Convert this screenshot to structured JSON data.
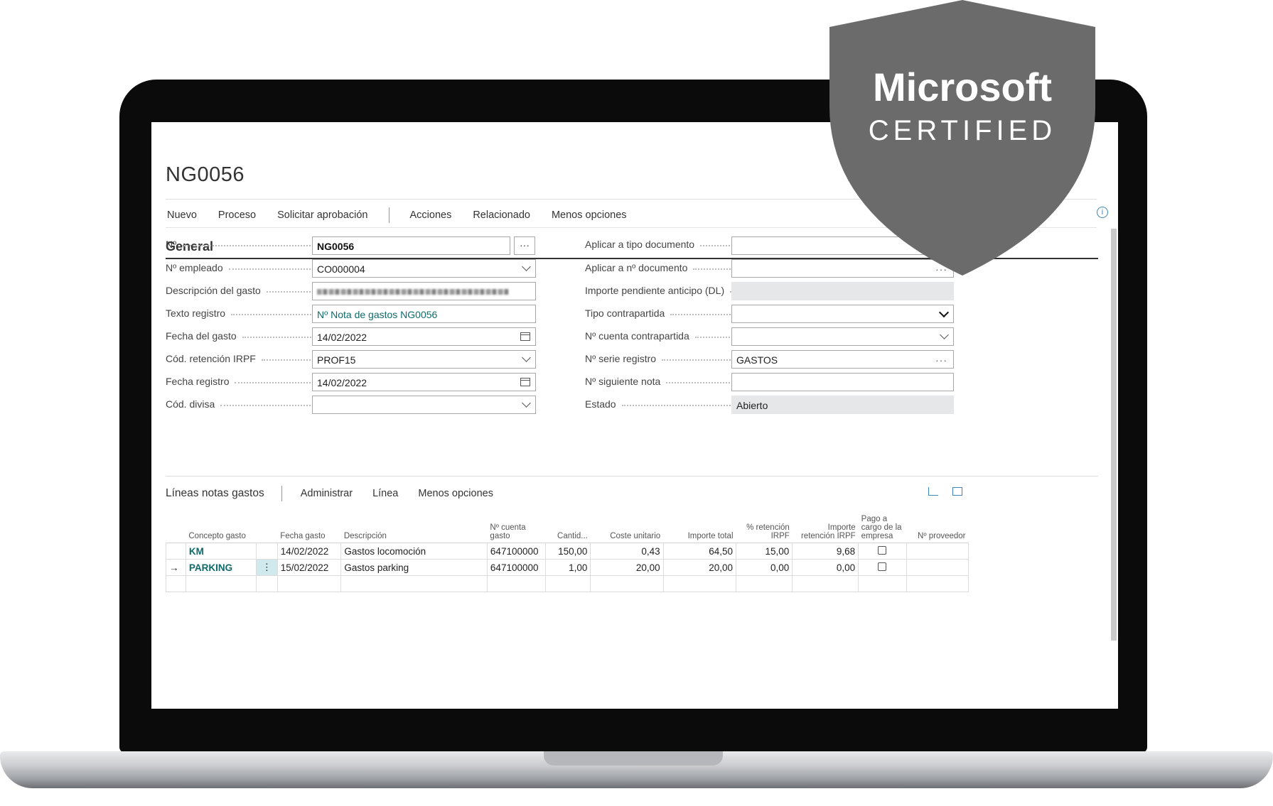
{
  "page": {
    "title": "NG0056",
    "actions": [
      "Nuevo",
      "Proceso",
      "Solicitar aprobación",
      "Acciones",
      "Relacionado",
      "Menos opciones"
    ]
  },
  "general": {
    "section_title": "General",
    "left_fields": [
      {
        "label": "Nº",
        "value": "NG0056"
      },
      {
        "label": "Nº empleado",
        "value": "CO000004"
      },
      {
        "label": "Descripción del gasto",
        "value": ""
      },
      {
        "label": "Texto registro",
        "value": "Nº Nota de gastos NG0056"
      },
      {
        "label": "Fecha del gasto",
        "value": "14/02/2022"
      },
      {
        "label": "Cód. retención IRPF",
        "value": "PROF15"
      },
      {
        "label": "Fecha registro",
        "value": "14/02/2022"
      },
      {
        "label": "Cód. divisa",
        "value": ""
      }
    ],
    "right_fields": [
      {
        "label": "Aplicar a tipo documento",
        "value": ""
      },
      {
        "label": "Aplicar a nº documento",
        "value": ""
      },
      {
        "label": "Importe pendiente anticipo (DL)",
        "value": ""
      },
      {
        "label": "Tipo contrapartida",
        "value": ""
      },
      {
        "label": "Nº cuenta contrapartida",
        "value": ""
      },
      {
        "label": "Nº serie registro",
        "value": "GASTOS"
      },
      {
        "label": "Nº siguiente nota",
        "value": ""
      },
      {
        "label": "Estado",
        "value": "Abierto"
      }
    ]
  },
  "lines": {
    "title": "Líneas notas gastos",
    "actions": [
      "Administrar",
      "Línea",
      "Menos opciones"
    ],
    "columns": [
      "Concepto gasto",
      "Fecha gasto",
      "Descripción",
      "Nº cuenta gasto",
      "Cantid...",
      "Coste unitario",
      "Importe total",
      "% retención IRPF",
      "Importe retención IRPF",
      "Pago a cargo de la empresa",
      "Nº proveedor"
    ],
    "rows": [
      {
        "concepto": "KM",
        "fecha": "14/02/2022",
        "descripcion": "Gastos locomoción",
        "cuenta": "647100000",
        "cantidad": "150,00",
        "coste": "0,43",
        "importe": "64,50",
        "retencion_pct": "15,00",
        "retencion_imp": "9,68",
        "pago_empresa": false,
        "proveedor": ""
      },
      {
        "concepto": "PARKING",
        "fecha": "15/02/2022",
        "descripcion": "Gastos parking",
        "cuenta": "647100000",
        "cantidad": "1,00",
        "coste": "20,00",
        "importe": "20,00",
        "retencion_pct": "0,00",
        "retencion_imp": "0,00",
        "pago_empresa": false,
        "proveedor": ""
      }
    ]
  },
  "badge": {
    "line1": "Microsoft",
    "line2": "CERTIFIED"
  },
  "icons": {
    "info": "info-icon",
    "share": "share-icon",
    "expand": "expand-icon",
    "row_arrow": "arrow-right-icon",
    "row_menu": "more-vertical-icon"
  },
  "colors": {
    "link": "#0f6b6b",
    "accent": "#3a86b8",
    "badge": "#6b6b6b",
    "readonly": "#e6e7e9"
  }
}
